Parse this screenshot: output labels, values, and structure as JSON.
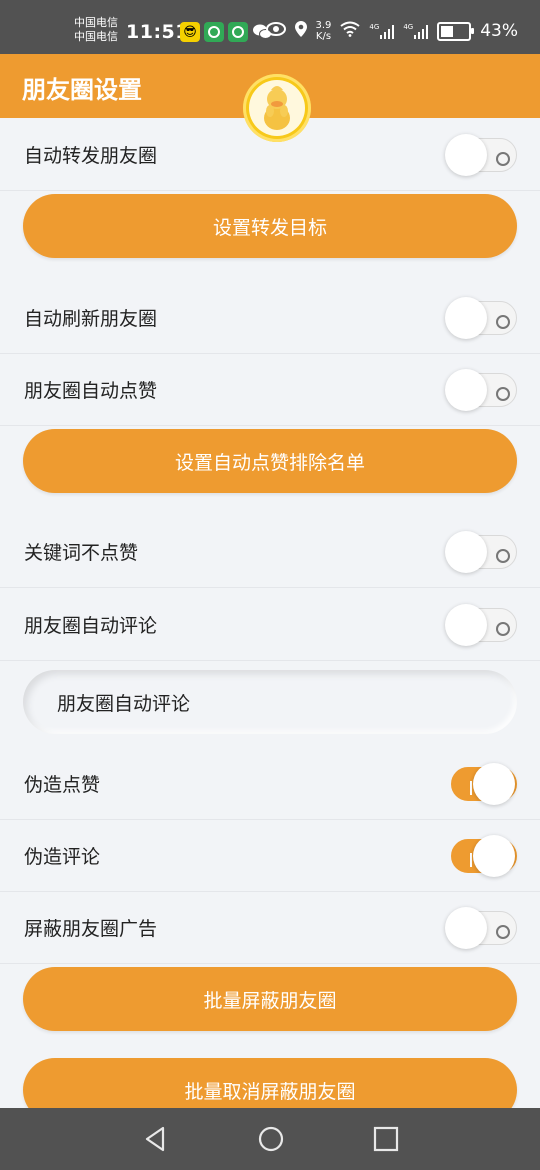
{
  "status_bar": {
    "carrier_1": "中国电信",
    "carrier_2": "中国电信",
    "time": "11:51",
    "speed_value": "3.9",
    "speed_unit": "K/s",
    "battery": "43%",
    "net_1": "4G",
    "net_2": "4G"
  },
  "header": {
    "title": "朋友圈设置",
    "accent_color": "#ee9b30"
  },
  "settings": {
    "auto_forward": {
      "label": "自动转发朋友圈",
      "enabled": false
    },
    "set_forward_target": {
      "label": "设置转发目标"
    },
    "auto_refresh": {
      "label": "自动刷新朋友圈",
      "enabled": false
    },
    "auto_like": {
      "label": "朋友圈自动点赞",
      "enabled": false
    },
    "set_like_exclude": {
      "label": "设置自动点赞排除名单"
    },
    "keyword_no_like": {
      "label": "关键词不点赞",
      "enabled": false
    },
    "auto_comment": {
      "label": "朋友圈自动评论",
      "enabled": false
    },
    "comment_input": {
      "value": "朋友圈自动评论"
    },
    "fake_like": {
      "label": "伪造点赞",
      "enabled": true
    },
    "fake_comment": {
      "label": "伪造评论",
      "enabled": true
    },
    "block_ads": {
      "label": "屏蔽朋友圈广告",
      "enabled": false
    },
    "batch_block": {
      "label": "批量屏蔽朋友圈"
    },
    "batch_unblock": {
      "label": "批量取消屏蔽朋友圈"
    }
  },
  "icons": {
    "back": "triangle-back-icon",
    "home": "circle-home-icon",
    "recents": "square-recents-icon"
  }
}
